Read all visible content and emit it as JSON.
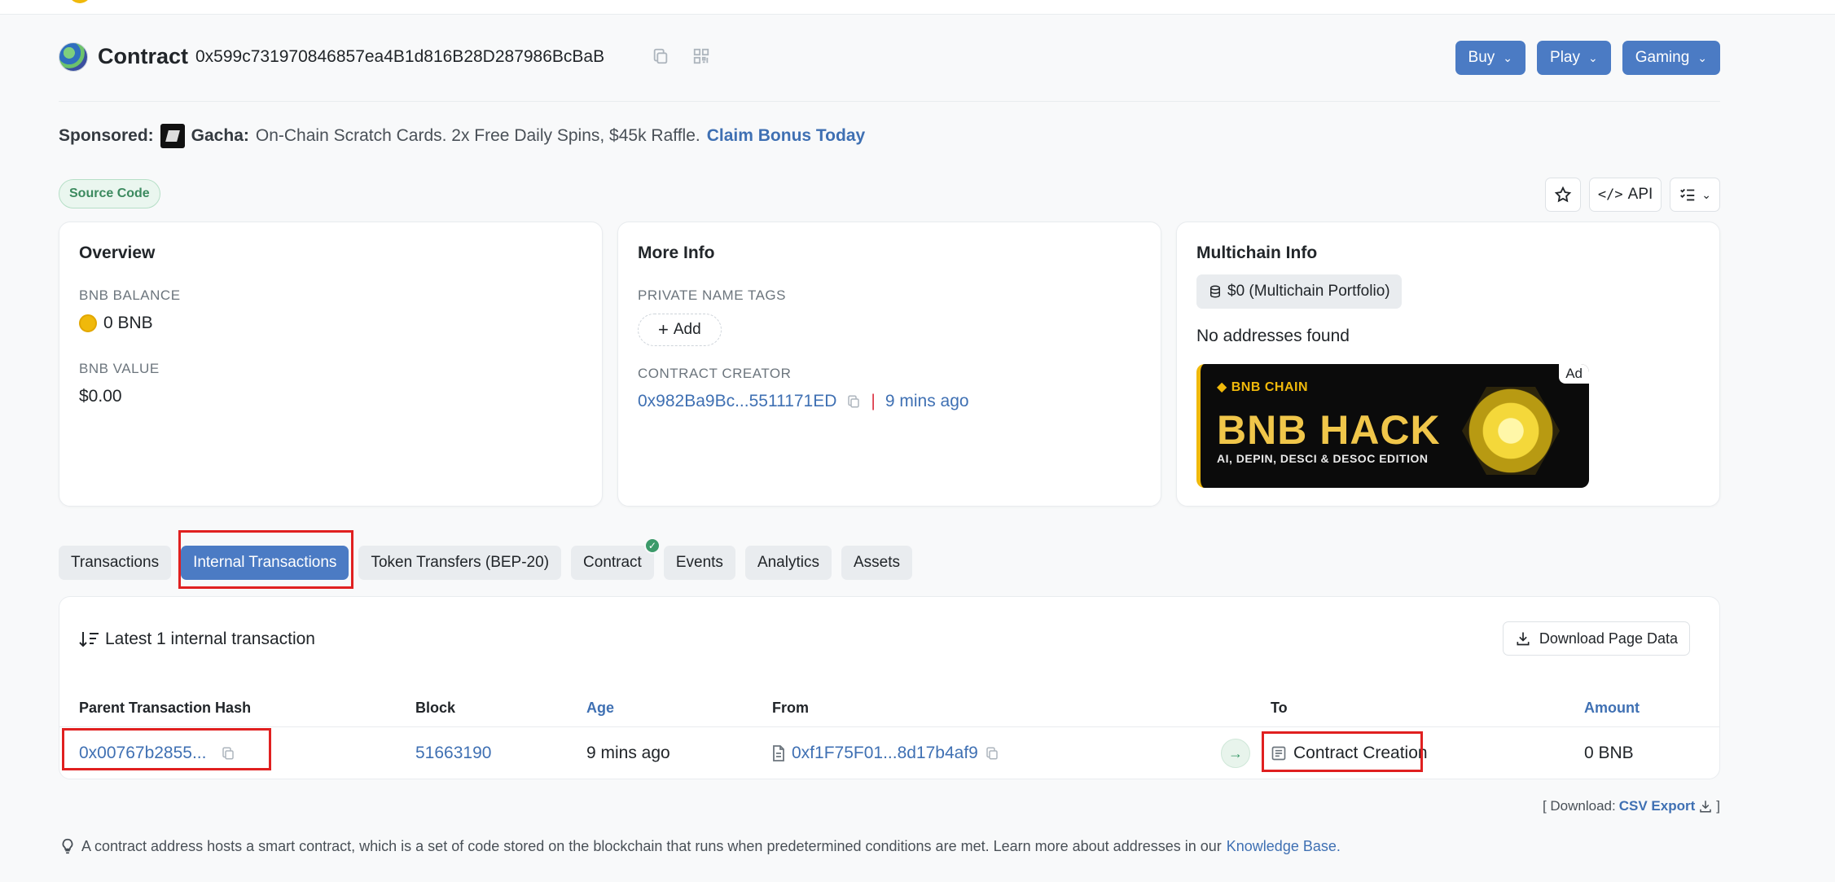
{
  "header": {
    "title": "Contract",
    "address": "0x599c731970846857ea4B1d816B28D287986BcBaB",
    "buttons": [
      "Buy",
      "Play",
      "Gaming"
    ]
  },
  "sponsored": {
    "label": "Sponsored:",
    "brand": "Gacha:",
    "text": "On-Chain Scratch Cards. 2x Free Daily Spins, $45k Raffle.",
    "cta": "Claim Bonus Today"
  },
  "badge": "Source Code",
  "tools": {
    "api": "API"
  },
  "overview": {
    "title": "Overview",
    "balance_label": "BNB BALANCE",
    "balance": "0 BNB",
    "value_label": "BNB VALUE",
    "value": "$0.00"
  },
  "more_info": {
    "title": "More Info",
    "tags_label": "PRIVATE NAME TAGS",
    "add_label": "Add",
    "creator_label": "CONTRACT CREATOR",
    "creator_address": "0x982Ba9Bc...5511171ED",
    "creator_age": "9 mins ago"
  },
  "multichain": {
    "title": "Multichain Info",
    "portfolio": "$0 (Multichain Portfolio)",
    "no_addresses": "No addresses found",
    "ad": {
      "tag": "Ad",
      "chain": "BNB CHAIN",
      "headline": "BNB HACK",
      "sub": "AI, DEPIN, DESCI & DESOC EDITION"
    }
  },
  "tabs": [
    "Transactions",
    "Internal Transactions",
    "Token Transfers (BEP-20)",
    "Contract",
    "Events",
    "Analytics",
    "Assets"
  ],
  "active_tab": "Internal Transactions",
  "table": {
    "latest": "Latest 1 internal transaction",
    "download_btn": "Download Page Data",
    "columns": [
      "Parent Transaction Hash",
      "Block",
      "Age",
      "From",
      "To",
      "Amount"
    ],
    "rows": [
      {
        "hash": "0x00767b2855...",
        "block": "51663190",
        "age": "9 mins ago",
        "from": "0xf1F75F01...8d17b4af9",
        "to": "Contract Creation",
        "amount": "0 BNB"
      }
    ]
  },
  "download": {
    "prefix": "[ Download:",
    "link": "CSV Export",
    "suffix": "]"
  },
  "footnote": {
    "text": "A contract address hosts a smart contract, which is a set of code stored on the blockchain that runs when predetermined conditions are met. Learn more about addresses in our",
    "link": "Knowledge Base."
  },
  "colors": {
    "primary": "#4b7bc4",
    "link": "#3f70b3",
    "highlight": "#e02020",
    "success": "#3c9a6a"
  }
}
